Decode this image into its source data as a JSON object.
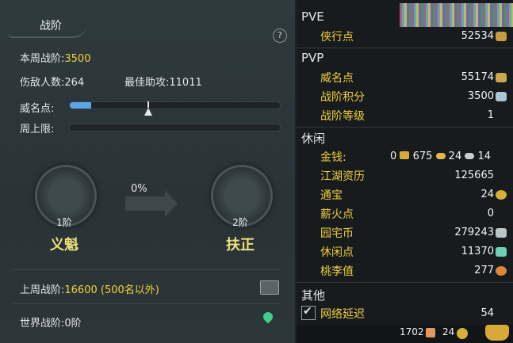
{
  "left": {
    "title": "战阶",
    "help": "?",
    "weekly_label": "本周战阶:",
    "weekly_value": "3500",
    "injured_label": "伤敌人数:",
    "injured_value": "264",
    "assist_label": "最佳助攻:",
    "assist_value": "11011",
    "prestige_label": "威名点:",
    "weekly_cap_label": "周上限:",
    "prestige_progress": 0.1,
    "progress_pct": "0%",
    "current_rank": {
      "level": "1阶",
      "name": "义魁"
    },
    "next_rank": {
      "level": "2阶",
      "name": "扶正"
    },
    "last_week_label": "上周战阶:",
    "last_week_value": "16600 (500名以外)",
    "world_label": "世界战阶:",
    "world_value": "0阶"
  },
  "right": {
    "pve": {
      "section": "PVE",
      "items": [
        {
          "label": "侠行点",
          "value": "52534"
        }
      ]
    },
    "pvp": {
      "section": "PVP",
      "items": [
        {
          "label": "威名点",
          "value": "55174"
        },
        {
          "label": "战阶积分",
          "value": "3500"
        },
        {
          "label": "战阶等级",
          "value": "1"
        }
      ]
    },
    "leisure": {
      "section": "休闲",
      "items": [
        {
          "label": "金钱:",
          "value": "0",
          "extra": [
            "675",
            "24",
            "14"
          ]
        },
        {
          "label": "江湖资历",
          "value": "125665"
        },
        {
          "label": "通宝",
          "value": "24"
        },
        {
          "label": "薪火点",
          "value": "0"
        },
        {
          "label": "园宅币",
          "value": "279243"
        },
        {
          "label": "休闲点",
          "value": "11370"
        },
        {
          "label": "桃李值",
          "value": "277"
        }
      ]
    },
    "other": {
      "section": "其他",
      "items": [
        {
          "label": "网络延迟",
          "value": "54",
          "checked": true
        }
      ]
    },
    "bottom": {
      "coupons": "1702",
      "tongbao": "24"
    }
  },
  "colors": {
    "accent_yellow": "#f0d23c",
    "progress_blue": "#5aa6e8"
  }
}
